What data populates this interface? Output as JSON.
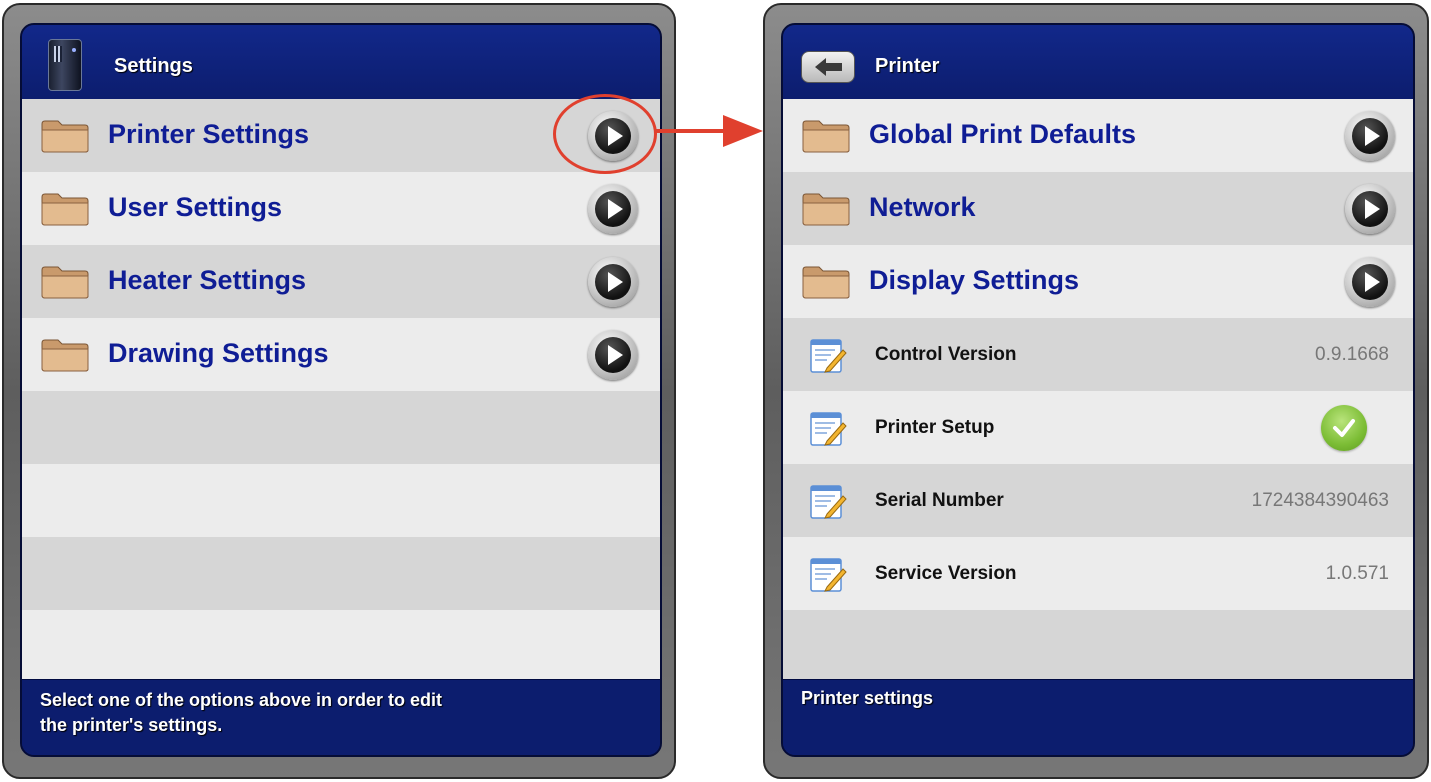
{
  "left_screen": {
    "header": {
      "title": "Settings",
      "icon": "printer-icon"
    },
    "items": [
      {
        "label": "Printer Settings",
        "icon": "folder-icon"
      },
      {
        "label": "User Settings",
        "icon": "folder-icon"
      },
      {
        "label": "Heater Settings",
        "icon": "folder-icon"
      },
      {
        "label": "Drawing Settings",
        "icon": "folder-icon"
      }
    ],
    "footer": {
      "line1": "Select one of the options above in order to edit",
      "line2": "the printer's settings."
    }
  },
  "right_screen": {
    "header": {
      "title": "Printer",
      "back_icon": "back-arrow-icon"
    },
    "items": [
      {
        "label": "Global Print Defaults",
        "icon": "folder-icon"
      },
      {
        "label": "Network",
        "icon": "folder-icon"
      },
      {
        "label": "Display Settings",
        "icon": "folder-icon"
      }
    ],
    "info_rows": [
      {
        "label": "Control Version",
        "value": "0.9.1668",
        "icon": "edit-document-icon"
      },
      {
        "label": "Printer Setup",
        "value_icon": "checkmark-icon",
        "icon": "edit-document-icon"
      },
      {
        "label": "Serial Number",
        "value": "1724384390463",
        "icon": "edit-document-icon"
      },
      {
        "label": "Service Version",
        "value": "1.0.571",
        "icon": "edit-document-icon"
      }
    ],
    "footer": {
      "text": "Printer settings"
    }
  },
  "annotation": {
    "highlight_color": "#e0402e"
  },
  "colors": {
    "header_blue": "#0c1d6e",
    "label_blue": "#0f1d95",
    "row_dark": "#d6d6d6",
    "row_light": "#ececec"
  }
}
